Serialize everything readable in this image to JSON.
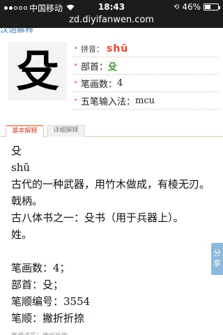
{
  "status_bar": {
    "carrier": "中国移动",
    "time": "18:43",
    "battery": "46%",
    "battery_level": 0.46
  },
  "url_bar": {
    "url": "zd.diyifanwen.com"
  },
  "peek_text": "汉语解释",
  "character": {
    "glyph": "殳"
  },
  "info": {
    "pinyin_label": "拼音：",
    "pinyin": "shū",
    "bushou_label": "部首：",
    "bushou": "殳",
    "strokes_label": "笔画数：",
    "strokes": "4",
    "wubi_label": "五笔输入法：",
    "wubi": "mcu"
  },
  "tabs": [
    {
      "label": "基本解释",
      "active": true
    },
    {
      "label": "详细解释",
      "active": false
    }
  ],
  "content": {
    "lines": [
      "殳",
      "shū",
      "古代的一种武器，用竹木做成，有棱无刃。",
      "戟柄。",
      "古八体书之一：殳书（用于兵器上）。",
      "姓。"
    ],
    "facts": [
      "笔画数：4；",
      "部首：殳；",
      "笔顺编号：3554",
      "笔顺：撇折折捺"
    ]
  },
  "share_button": {
    "label": "分享"
  },
  "footer_peek": "笔顺读写：撇折折捺"
}
